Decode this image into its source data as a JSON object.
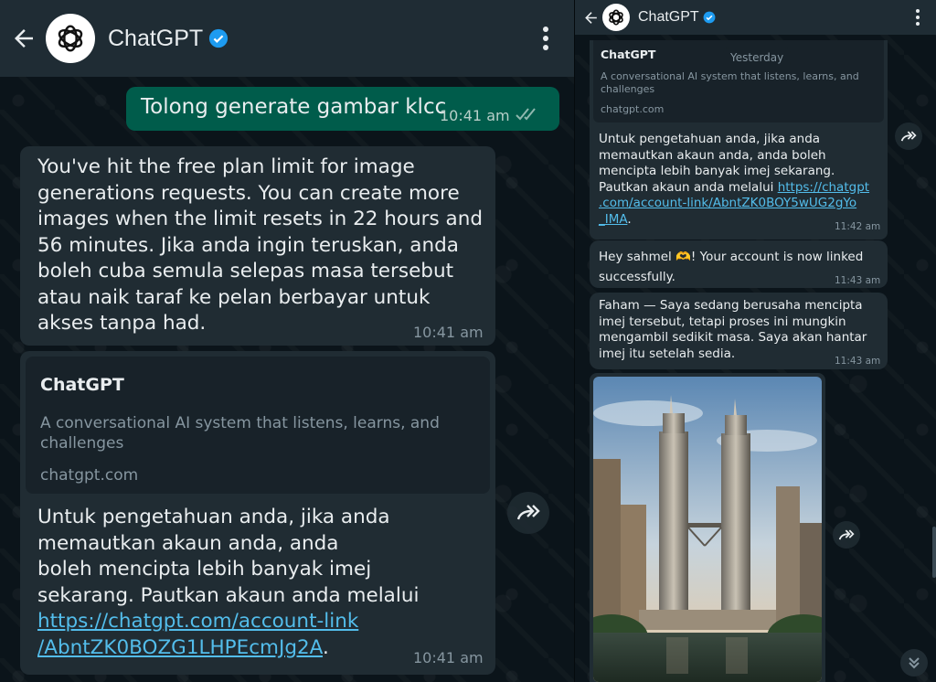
{
  "left": {
    "contact_name": "ChatGPT",
    "outgoing": {
      "text": "Tolong generate gambar klcc",
      "time": "10:41 am"
    },
    "reply1": {
      "lines": [
        "You've hit the free plan limit for image",
        "generations requests. You can create more",
        "images when the limit resets in 22 hours and",
        "56 minutes. Jika anda ingin teruskan, anda",
        "boleh cuba semula selepas masa tersebut",
        "atau naik taraf ke pelan berbayar untuk",
        "akses tanpa had."
      ],
      "time": "10:41 am"
    },
    "preview": {
      "title": "ChatGPT",
      "desc_lines": [
        "A conversational AI system that listens, learns, and",
        "challenges"
      ],
      "domain": "chatgpt.com"
    },
    "reply2": {
      "lines": [
        "Untuk pengetahuan anda, jika anda",
        "memautkan akaun anda, anda",
        "boleh mencipta lebih banyak imej",
        "sekarang. Pautkan akaun anda melalui"
      ],
      "link_lines": [
        "https://chatgpt.com/account-link",
        "/AbntZK0BOZG1LHPEcmJg2A"
      ],
      "link_suffix": ".",
      "time": "10:41 am"
    }
  },
  "right": {
    "contact_name": "ChatGPT",
    "date_chip": "Yesterday",
    "preview": {
      "title": "ChatGPT",
      "desc_lines": [
        "A conversational AI system that listens, learns, and",
        "challenges"
      ],
      "domain": "chatgpt.com"
    },
    "msg1": {
      "lines": [
        "Untuk pengetahuan anda, jika anda",
        "memautkan akaun anda, anda boleh",
        "mencipta lebih banyak imej sekarang."
      ],
      "line4_prefix": "Pautkan akaun anda melalui ",
      "link_lines": [
        "https://chatgpt",
        ".com/account-link/AbntZK0BOY5wUG2gYo",
        "_IMA"
      ],
      "link_suffix": ".",
      "time": "11:42 am"
    },
    "msg2": {
      "line1_prefix": "Hey sahmel ",
      "emoji": "🫶",
      "line1_suffix": "! Your account is now linked",
      "line2": "successfully.",
      "time": "11:43 am"
    },
    "msg3": {
      "lines": [
        "Faham — Saya sedang berusaha mencipta",
        "imej tersebut, tetapi proses ini mungkin",
        "mengambil sedikit masa. Saya akan hantar",
        "imej itu setelah sedia."
      ],
      "time": "11:43 am"
    },
    "image": {
      "subject": "petronas-twin-towers-klcc"
    }
  },
  "icons": {
    "back": "arrow-back-icon",
    "verified": "verified-badge-icon",
    "menu": "more-vert-icon",
    "forward": "forward-icon",
    "scroll": "chevron-double-down-icon",
    "read": "double-check-icon"
  },
  "colors": {
    "bg": "#0b141a",
    "header": "#1f2c34",
    "incoming": "#202c33",
    "outgoing": "#005c4b",
    "link": "#53bdeb",
    "meta": "#8696a0",
    "read_tick": "#53bdeb"
  }
}
